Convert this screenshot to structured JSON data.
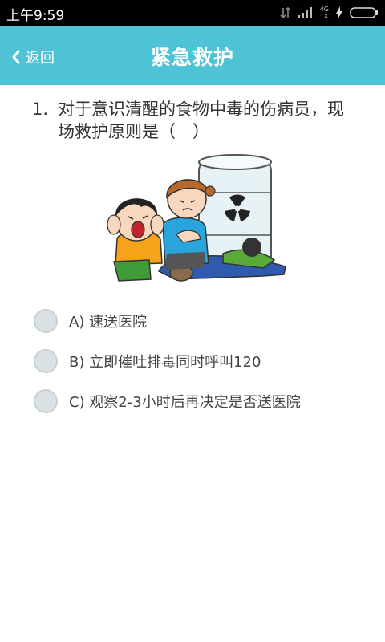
{
  "status": {
    "time": "上午9:59",
    "network": "4G",
    "network_sub": "1X"
  },
  "appbar": {
    "back_label": "返回",
    "title": "紧急救护"
  },
  "question": {
    "number": "1.",
    "text": "对于意识清醒的食物中毒的伤病员，现场救护原则是（　）",
    "illustration": "people-near-radiation-barrel-illustration"
  },
  "options": [
    {
      "label": "A) 速送医院",
      "selected": false
    },
    {
      "label": "B) 立即催吐排毒同时呼叫120",
      "selected": false
    },
    {
      "label": "C) 观察2-3小时后再决定是否送医院",
      "selected": false
    }
  ],
  "colors": {
    "appbar": "#4fc3d6",
    "radio": "#d9e1e4",
    "text": "#333333"
  }
}
